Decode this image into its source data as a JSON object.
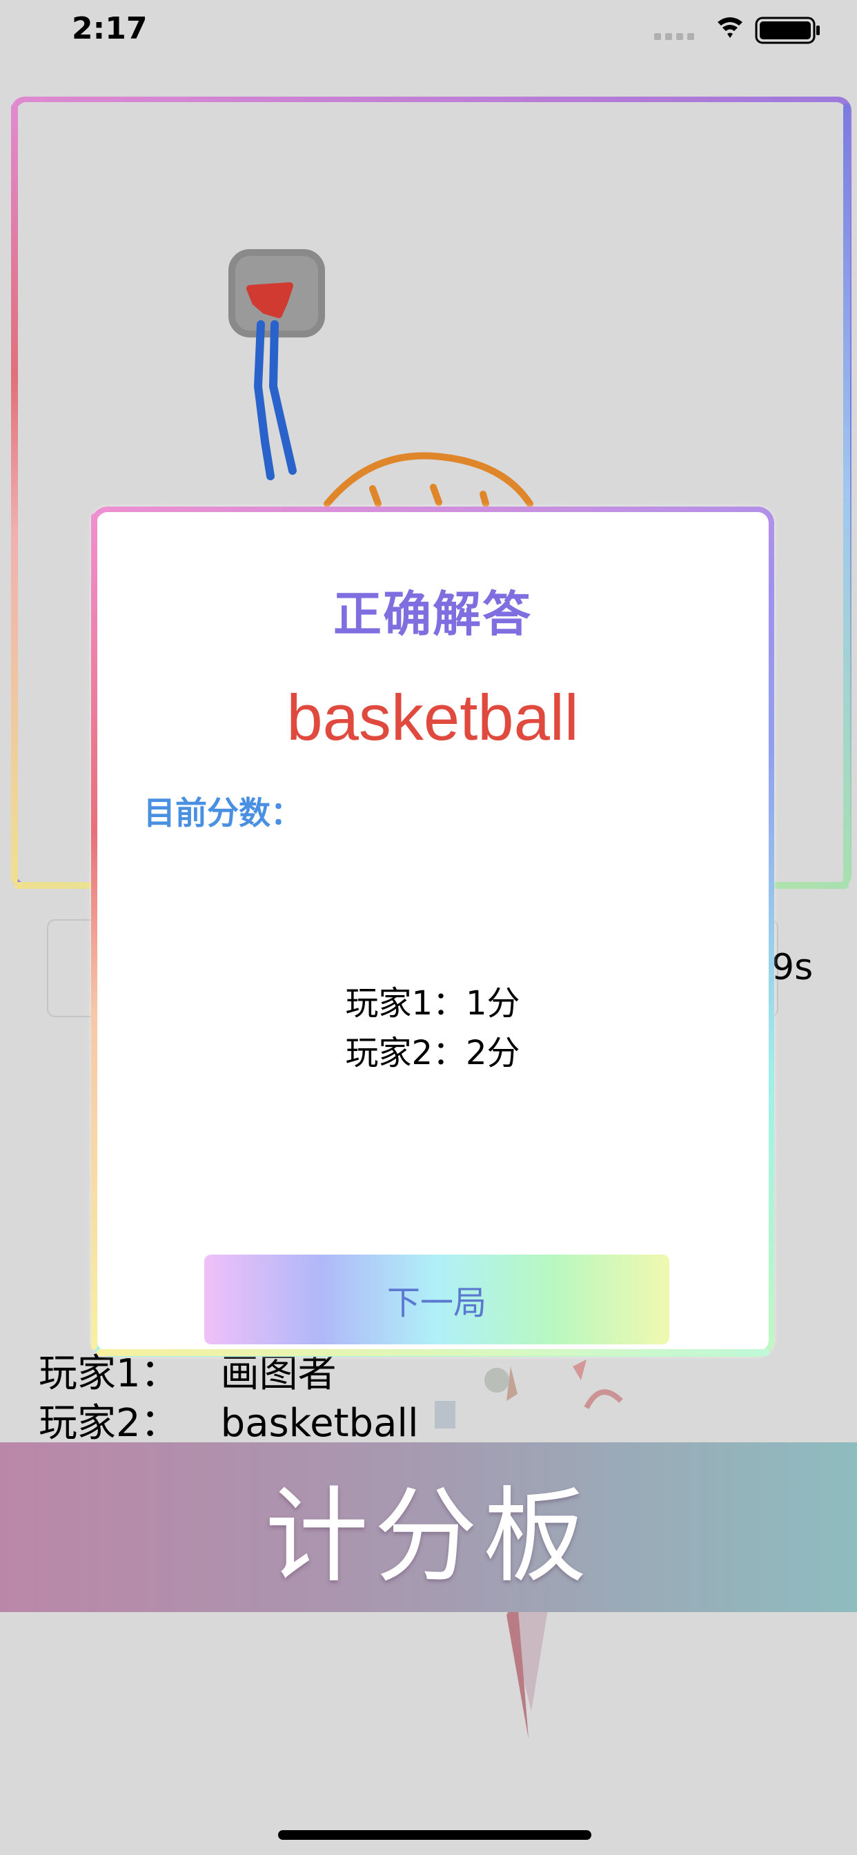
{
  "status_bar": {
    "time": "2:17"
  },
  "game": {
    "timer": "9s",
    "players": [
      {
        "name": "玩家1：",
        "value": "画图者"
      },
      {
        "name": "玩家2：",
        "value": "basketball"
      }
    ]
  },
  "modal": {
    "title": "正确解答",
    "answer": "basketball",
    "score_label": "目前分数：",
    "scores": [
      "玩家1：1分",
      "玩家2：2分"
    ],
    "next_button": "下一局"
  },
  "banner": {
    "text": "计分板"
  },
  "colors": {
    "answer": "#e04a3e",
    "title": "#7e6ee0",
    "score_label": "#4a90e2",
    "button_text": "#5a78d0"
  }
}
